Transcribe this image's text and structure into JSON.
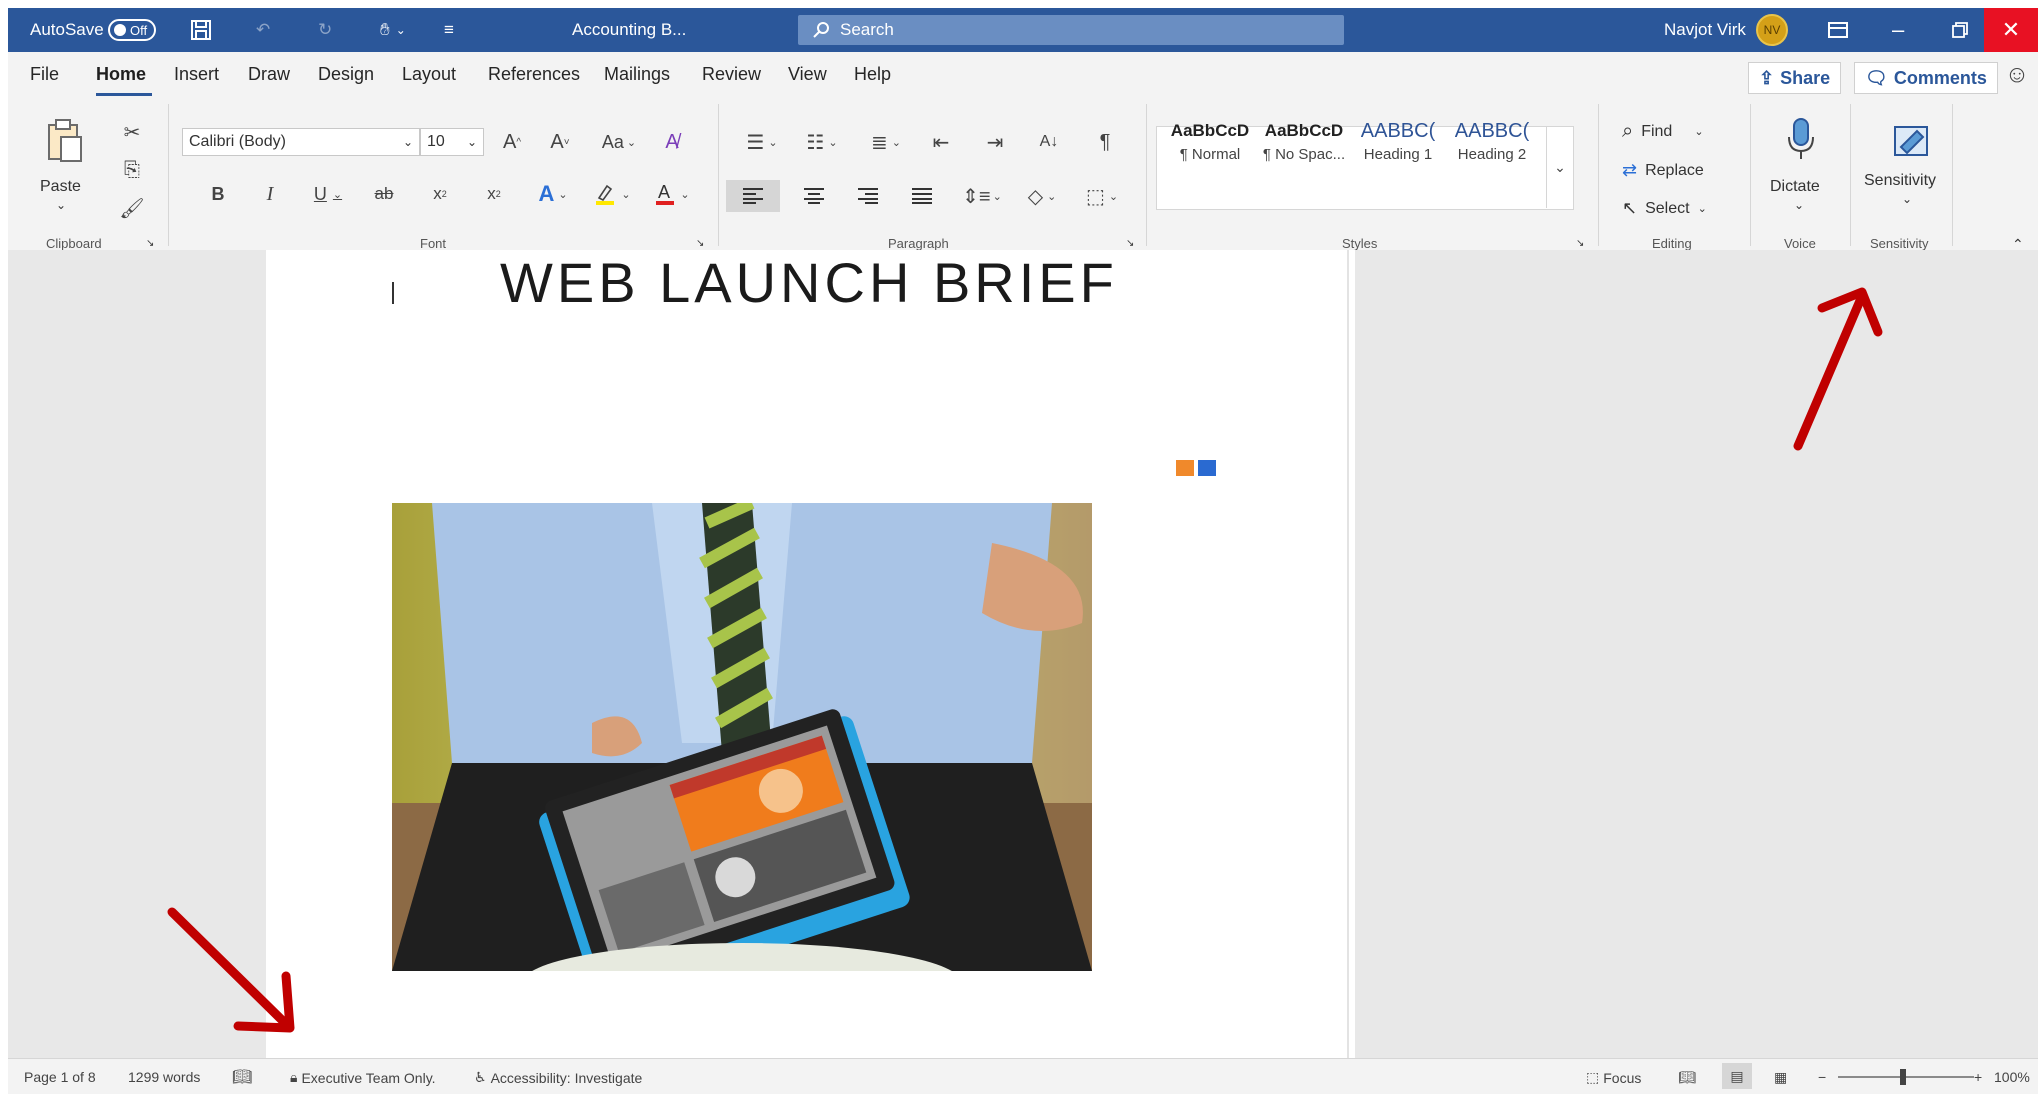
{
  "titlebar": {
    "autosave_label": "AutoSave",
    "autosave_state": "Off",
    "doc_title": "Accounting B...",
    "search_placeholder": "Search",
    "user_name": "Navjot Virk",
    "user_initials": "NV",
    "accent_color": "#2b579a",
    "close_color": "#e81123"
  },
  "menu": {
    "items": [
      "File",
      "Home",
      "Insert",
      "Draw",
      "Design",
      "Layout",
      "References",
      "Mailings",
      "Review",
      "View",
      "Help"
    ],
    "active": "Home",
    "share_label": "Share",
    "comments_label": "Comments"
  },
  "ribbon": {
    "clipboard": {
      "paste_label": "Paste",
      "group_label": "Clipboard"
    },
    "font": {
      "font_name": "Calibri (Body)",
      "font_size": "10",
      "case_label": "Aa",
      "group_label": "Font"
    },
    "paragraph": {
      "group_label": "Paragraph"
    },
    "styles": {
      "group_label": "Styles",
      "items": [
        {
          "sample": "AaBbCcD",
          "name": "¶ Normal"
        },
        {
          "sample": "AaBbCcD",
          "name": "¶ No Spac..."
        },
        {
          "sample": "AABBC(",
          "name": "Heading 1"
        },
        {
          "sample": "AABBC(",
          "name": "Heading 2"
        }
      ]
    },
    "editing": {
      "find_label": "Find",
      "replace_label": "Replace",
      "select_label": "Select",
      "group_label": "Editing"
    },
    "voice": {
      "dictate_label": "Dictate",
      "group_label": "Voice"
    },
    "sensitivity": {
      "button_label": "Sensitivity",
      "group_label": "Sensitivity"
    }
  },
  "document": {
    "title": "WEB LAUNCH BRIEF",
    "accent_squares": [
      "#f0892b",
      "#2a6ad1"
    ]
  },
  "statusbar": {
    "page": "Page 1 of 8",
    "words": "1299 words",
    "sensitivity": "Executive Team Only.",
    "accessibility": "Accessibility: Investigate",
    "focus": "Focus",
    "zoom": "100%"
  },
  "annotations": {
    "arrow_color": "#c00000"
  }
}
